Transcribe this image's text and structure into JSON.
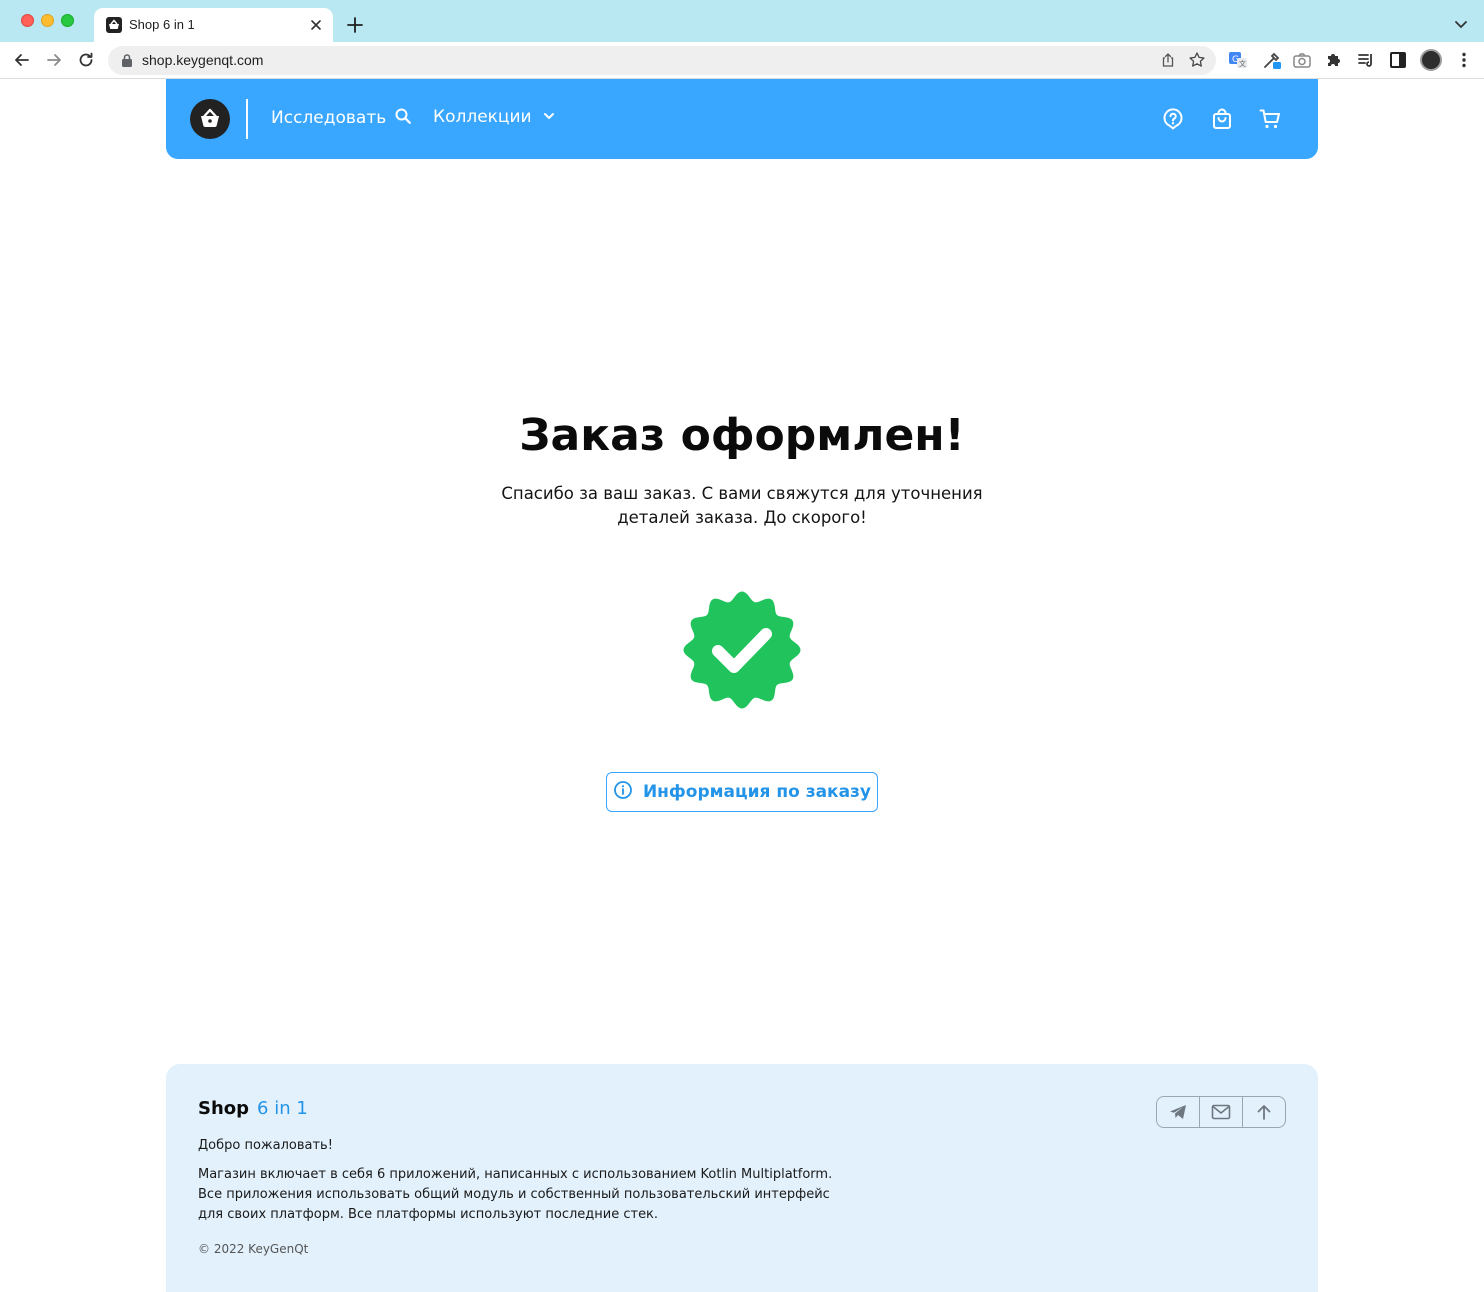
{
  "browser": {
    "tab_title": "Shop 6 in 1",
    "url": "shop.keygenqt.com"
  },
  "header": {
    "explore_label": "Исследовать",
    "collections_label": "Коллекции"
  },
  "main": {
    "title": "Заказ оформлен!",
    "subtitle": "Спасибо за ваш заказ. С вами свяжутся для уточнения деталей заказа. До скорого!",
    "order_info_label": "Информация по заказу"
  },
  "footer": {
    "brand_main": "Shop",
    "brand_accent": "6 in 1",
    "welcome": "Добро пожаловать!",
    "description": "Магазин включает в себя 6 приложений, написанных с использованием Kotlin Multiplatform. Все приложения использовать общий модуль и собственный пользовательский интерфейс для своих платформ. Все платформы используют последние стек.",
    "copyright": "© 2022 KeyGenQt"
  },
  "colors": {
    "header_bg": "#39a6ff",
    "accent": "#2394e8",
    "success": "#21c35c",
    "footer_bg": "#e2f1fc",
    "tabstrip_bg": "#b9e8f3"
  },
  "icons": {
    "explore": "search-icon",
    "collections": "chevron-down-icon",
    "help": "help-icon",
    "orders": "shopping-bag-icon",
    "cart": "cart-icon",
    "success": "check-badge-icon",
    "info": "info-icon",
    "telegram": "telegram-icon",
    "email": "mail-icon",
    "scroll_top": "arrow-up-icon"
  }
}
